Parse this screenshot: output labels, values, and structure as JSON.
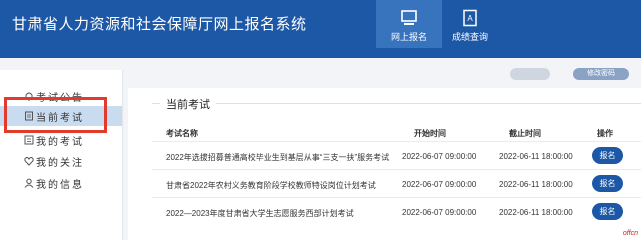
{
  "header": {
    "app_title": "甘肃省人力资源和社会保障厅网上报名系统",
    "nav": [
      {
        "label": "网上报名",
        "icon": "monitor-icon"
      },
      {
        "label": "成绩查询",
        "icon": "score-doc-icon"
      }
    ]
  },
  "topbar": {
    "change_password": "修改密码"
  },
  "sidebar": {
    "items": [
      {
        "label": "考试公告",
        "icon": "bell-icon"
      },
      {
        "label": "当前考试",
        "icon": "doc-icon"
      },
      {
        "label": "我的考试",
        "icon": "list-icon"
      },
      {
        "label": "我的关注",
        "icon": "heart-icon"
      },
      {
        "label": "我的信息",
        "icon": "user-icon"
      }
    ]
  },
  "main": {
    "section_title": "当前考试",
    "columns": [
      "考试名称",
      "开始时间",
      "截止时间",
      "操作"
    ],
    "rows": [
      {
        "name": "2022年选拔招募普通高校毕业生到基层从事“三支一扶”服务考试",
        "start": "2022-06-07 09:00:00",
        "end": "2022-06-11 18:00:00",
        "action": "报名"
      },
      {
        "name": "甘肃省2022年农村义务教育阶段学校教师特设岗位计划考试",
        "start": "2022-06-07 09:00:00",
        "end": "2022-06-11 18:00:00",
        "action": "报名"
      },
      {
        "name": "2022—2023年度甘肃省大学生志愿服务西部计划考试",
        "start": "2022-06-07 09:00:00",
        "end": "2022-06-11 18:00:00",
        "action": "报名"
      }
    ]
  },
  "watermark": "offcn",
  "colors": {
    "brand": "#1d58a7",
    "highlight": "#e33a2e"
  }
}
